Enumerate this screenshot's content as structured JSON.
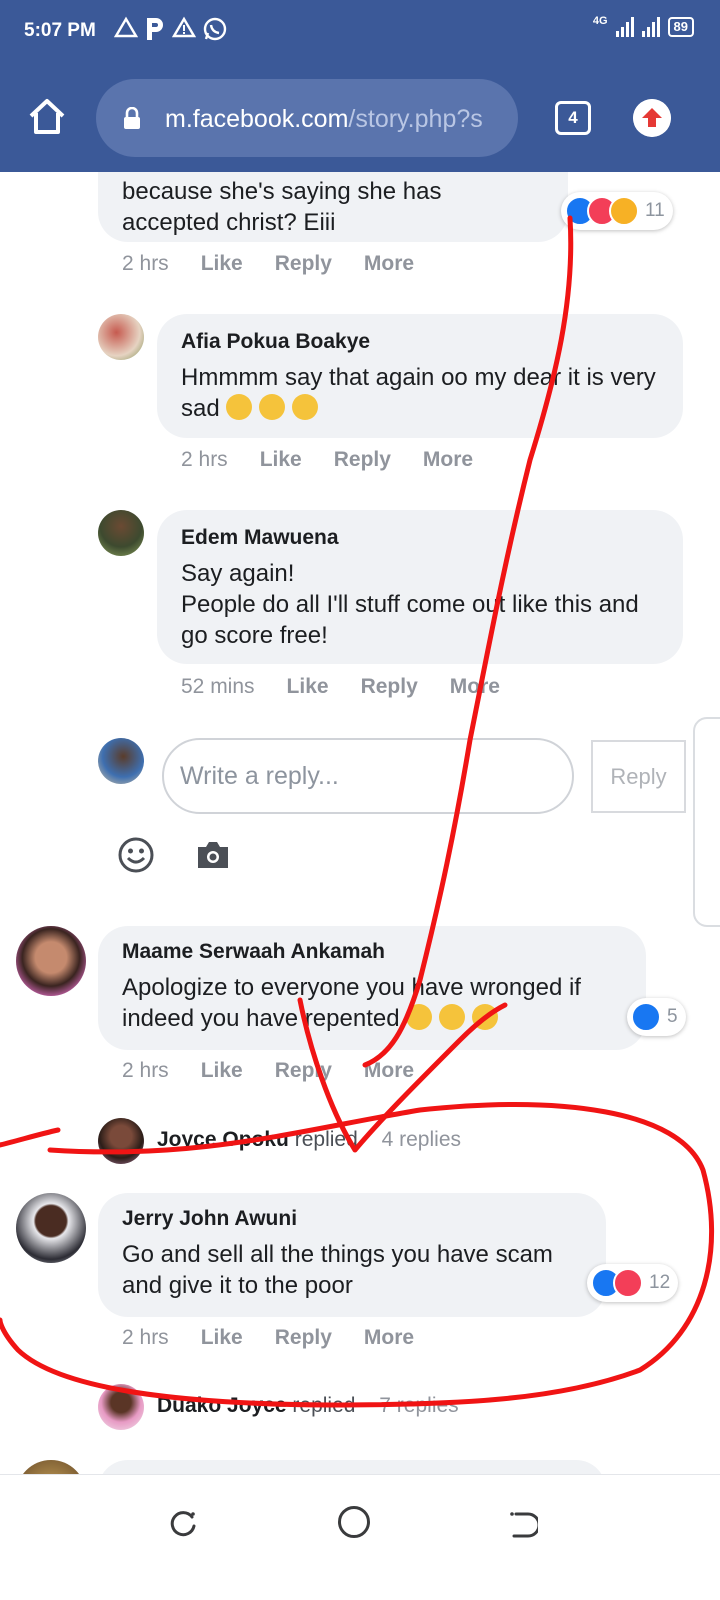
{
  "status_bar": {
    "time": "5:07 PM",
    "network": "4G",
    "battery": "89"
  },
  "browser": {
    "url_host": "m.facebook.com",
    "url_path": "/story.php?s",
    "tab_count": "4"
  },
  "comments": [
    {
      "text": "because she's saying she has accepted christ? Eiii",
      "time": "2 hrs",
      "reaction_count": "11",
      "reactions": [
        "like",
        "love",
        "sad"
      ]
    },
    {
      "author": "Afia Pokua Boakye",
      "text": "Hmmmm say that again oo my dear it is very sad",
      "time": "2 hrs"
    },
    {
      "author": "Edem Mawuena",
      "text_line1": "Say again!",
      "text_line2": "People do all I'll stuff come out like this and go score free!",
      "time": "52 mins"
    },
    {
      "author": "Maame Serwaah Ankamah",
      "text": "Apologize to everyone you have wronged if indeed you have repented",
      "time": "2 hrs",
      "reaction_count": "5",
      "reactions": [
        "like"
      ]
    },
    {
      "author": "Jerry John Awuni",
      "text": "Go and sell all the things you have scam and give it to the poor",
      "time": "2 hrs",
      "reaction_count": "12",
      "reactions": [
        "like",
        "love"
      ]
    }
  ],
  "actions": {
    "like": "Like",
    "reply": "Reply",
    "more": "More"
  },
  "reply_box": {
    "placeholder": "Write a reply...",
    "button": "Reply"
  },
  "replied_rows": [
    {
      "name": "Joyce Opoku",
      "verb": "replied",
      "count": "4 replies"
    },
    {
      "name": "Duako Joyce",
      "verb": "replied",
      "count": "7 replies"
    }
  ],
  "colors": {
    "header": "#3b5998",
    "bubble": "#f0f2f5",
    "annotation": "#f01414"
  }
}
